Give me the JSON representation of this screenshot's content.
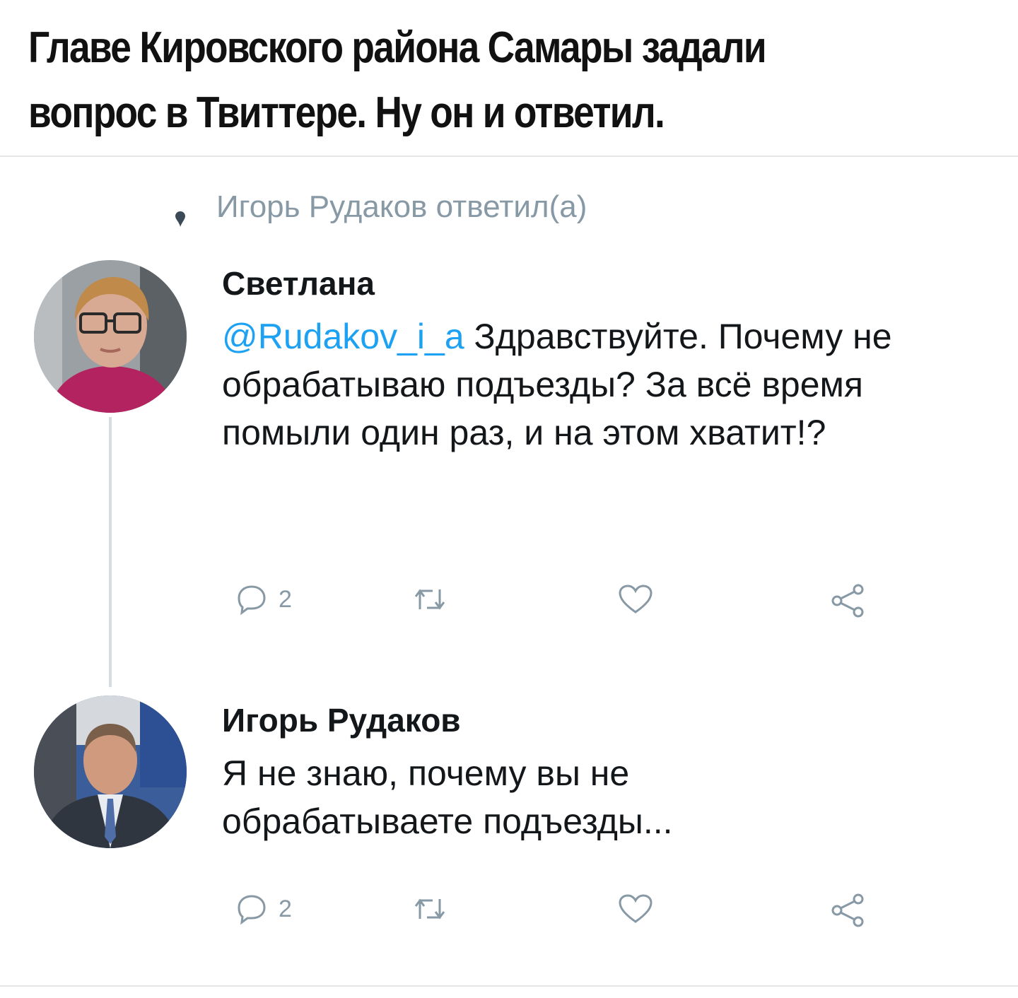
{
  "caption": {
    "text": "Главе Кировского района Самары задали\nвопрос в Твиттере. Ну он и ответил."
  },
  "reply_context": {
    "text": "Игорь Рудаков ответил(а)"
  },
  "tweets": [
    {
      "author": "Светлана",
      "mention": "@Rudakov_i_a",
      "text_after_mention": " Здравствуйте. Почему не обрабатываю подъезды? За всё время помыли один раз, и на этом хватит!?",
      "reply_count": "2"
    },
    {
      "author": "Игорь Рудаков",
      "text": "Я не знаю, почему вы не обрабатываете подъезды...",
      "reply_count": "2"
    }
  ],
  "icons": {
    "reply": "reply-icon",
    "retweet": "retweet-icon",
    "like": "heart-icon",
    "share": "share-icon"
  },
  "colors": {
    "mention": "#1da1f2",
    "muted": "#8899a6",
    "thread_line": "#d6dde2"
  }
}
